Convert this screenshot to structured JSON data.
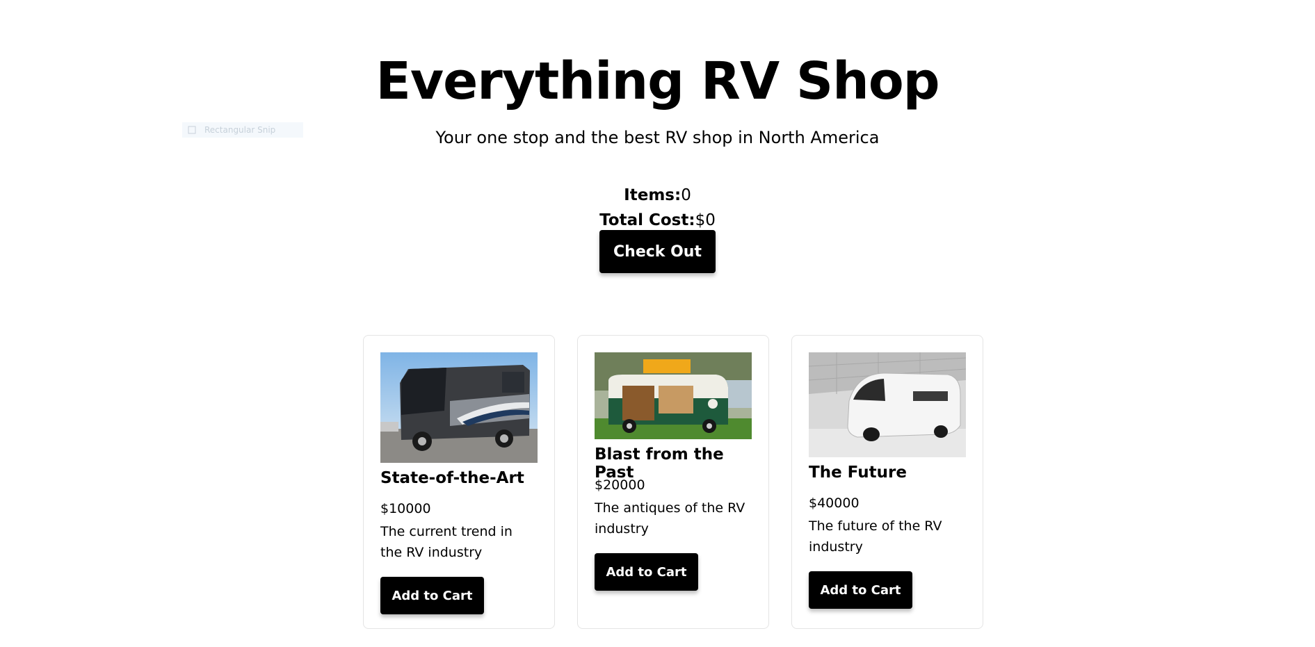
{
  "header": {
    "title": "Everything RV Shop",
    "subtitle": "Your one stop and the best RV shop in North America"
  },
  "overlay": {
    "label": "Rectangular Snip"
  },
  "cart": {
    "items_label": "Items:",
    "items_value": "0",
    "cost_label": "Total Cost:",
    "cost_value": "$0",
    "checkout_label": "Check Out"
  },
  "products": [
    {
      "name": "State-of-the-Art",
      "price": "$10000",
      "description": "The current trend in the RV industry",
      "button": "Add to Cart",
      "image": "modern-motorhome-photo"
    },
    {
      "name": "Blast from the Past",
      "price": "$20000",
      "description": "The antiques of the RV industry",
      "button": "Add to Cart",
      "image": "vintage-camper-van-photo"
    },
    {
      "name": "The Future",
      "price": "$40000",
      "description": "The future of the RV industry",
      "button": "Add to Cart",
      "image": "futuristic-van-photo"
    }
  ]
}
